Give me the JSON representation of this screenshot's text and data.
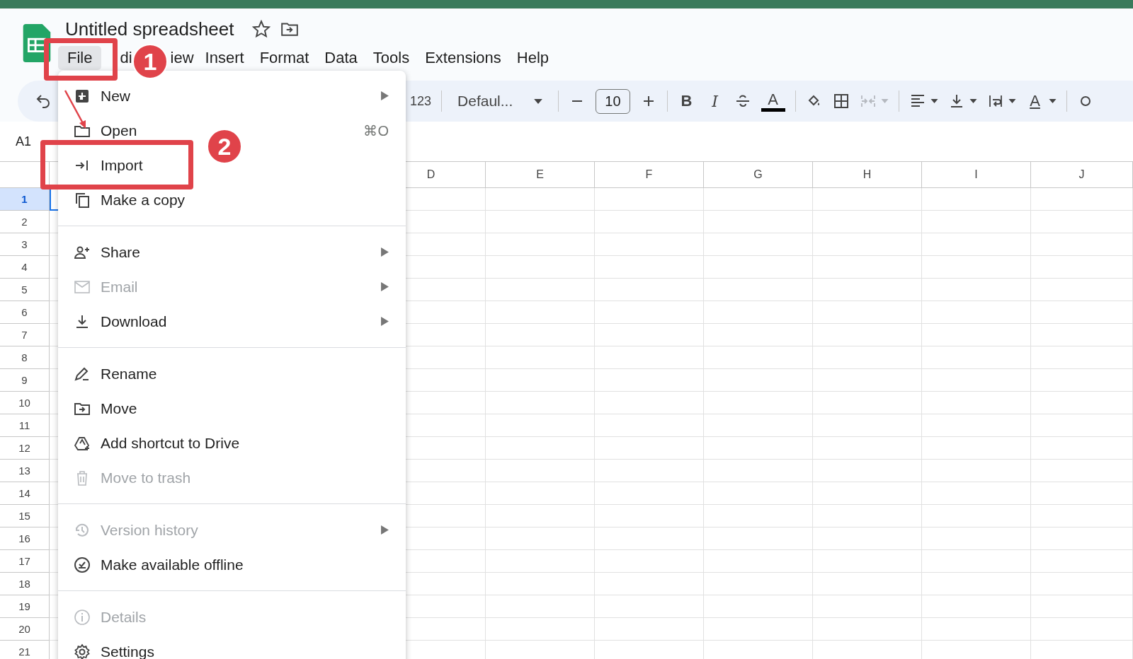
{
  "document": {
    "title": "Untitled spreadsheet"
  },
  "menu_bar": [
    {
      "label": "File",
      "selected": true
    },
    {
      "label": "di",
      "selected": false
    },
    {
      "label": "iew",
      "selected": false
    },
    {
      "label": "Insert",
      "selected": false
    },
    {
      "label": "Format",
      "selected": false
    },
    {
      "label": "Data",
      "selected": false
    },
    {
      "label": "Tools",
      "selected": false
    },
    {
      "label": "Extensions",
      "selected": false
    },
    {
      "label": "Help",
      "selected": false
    }
  ],
  "toolbar": [
    {
      "kind": "text",
      "label": "123"
    },
    {
      "kind": "divider"
    },
    {
      "kind": "dropdown",
      "label": "Defaul..."
    },
    {
      "kind": "divider"
    },
    {
      "kind": "minus"
    },
    {
      "kind": "field",
      "label": "10"
    },
    {
      "kind": "plus"
    },
    {
      "kind": "divider"
    },
    {
      "kind": "bold",
      "label": "B"
    },
    {
      "kind": "italic",
      "label": "I"
    },
    {
      "kind": "strike"
    },
    {
      "kind": "textcolor",
      "label": "A"
    },
    {
      "kind": "divider"
    },
    {
      "kind": "fill"
    },
    {
      "kind": "borders"
    },
    {
      "kind": "merge",
      "caret": true,
      "disabled": true
    },
    {
      "kind": "divider"
    },
    {
      "kind": "align",
      "caret": true
    },
    {
      "kind": "valign",
      "caret": true
    },
    {
      "kind": "wrap",
      "caret": true
    },
    {
      "kind": "rotate",
      "label": "A",
      "caret": true
    },
    {
      "kind": "divider"
    }
  ],
  "name_box": "A1",
  "columns": [
    "D",
    "E",
    "F",
    "G",
    "H",
    "I",
    "J"
  ],
  "rows": [
    {
      "label": "1",
      "selected": true
    },
    {
      "label": "2",
      "selected": false
    },
    {
      "label": "3",
      "selected": false
    },
    {
      "label": "4",
      "selected": false
    },
    {
      "label": "5",
      "selected": false
    },
    {
      "label": "6",
      "selected": false
    },
    {
      "label": "7",
      "selected": false
    },
    {
      "label": "8",
      "selected": false
    },
    {
      "label": "9",
      "selected": false
    },
    {
      "label": "10",
      "selected": false
    },
    {
      "label": "11",
      "selected": false
    },
    {
      "label": "12",
      "selected": false
    },
    {
      "label": "13",
      "selected": false
    },
    {
      "label": "14",
      "selected": false
    },
    {
      "label": "15",
      "selected": false
    },
    {
      "label": "16",
      "selected": false
    },
    {
      "label": "17",
      "selected": false
    },
    {
      "label": "18",
      "selected": false
    },
    {
      "label": "19",
      "selected": false
    },
    {
      "label": "20",
      "selected": false
    },
    {
      "label": "21",
      "selected": false
    }
  ],
  "file_menu": [
    {
      "kind": "item",
      "label": "New",
      "submenu": true,
      "disabled": false
    },
    {
      "kind": "item",
      "label": "Open",
      "shortcut": "⌘O",
      "submenu": false,
      "disabled": false
    },
    {
      "kind": "item",
      "label": "Import",
      "submenu": false,
      "disabled": false
    },
    {
      "kind": "item",
      "label": "Make a copy",
      "submenu": false,
      "disabled": false
    },
    {
      "kind": "divider"
    },
    {
      "kind": "item",
      "label": "Share",
      "submenu": true,
      "disabled": false
    },
    {
      "kind": "item",
      "label": "Email",
      "submenu": true,
      "disabled": true
    },
    {
      "kind": "item",
      "label": "Download",
      "submenu": true,
      "disabled": false
    },
    {
      "kind": "divider"
    },
    {
      "kind": "item",
      "label": "Rename",
      "submenu": false,
      "disabled": false
    },
    {
      "kind": "item",
      "label": "Move",
      "submenu": false,
      "disabled": false
    },
    {
      "kind": "item",
      "label": "Add shortcut to Drive",
      "submenu": false,
      "disabled": false
    },
    {
      "kind": "item",
      "label": "Move to trash",
      "submenu": false,
      "disabled": true
    },
    {
      "kind": "divider"
    },
    {
      "kind": "item",
      "label": "Version history",
      "submenu": true,
      "disabled": true
    },
    {
      "kind": "item",
      "label": "Make available offline",
      "submenu": false,
      "disabled": false
    },
    {
      "kind": "divider"
    },
    {
      "kind": "item",
      "label": "Details",
      "submenu": false,
      "disabled": true
    },
    {
      "kind": "item",
      "label": "Settings",
      "submenu": false,
      "disabled": false
    }
  ],
  "annotations": [
    {
      "kind": "box"
    },
    {
      "kind": "badge",
      "label": "1"
    },
    {
      "kind": "arrow"
    },
    {
      "kind": "box"
    },
    {
      "kind": "badge",
      "label": "2"
    }
  ]
}
